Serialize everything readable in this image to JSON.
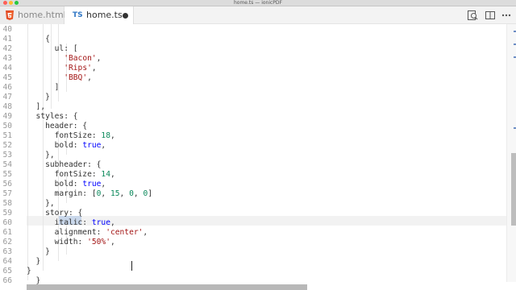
{
  "window": {
    "title": "home.ts — ionicPDF"
  },
  "tabs": [
    {
      "label": "home.html",
      "icon": "html5-icon",
      "active": false
    },
    {
      "label": "home.ts",
      "icon": "typescript-icon",
      "icon_text": "TS",
      "active": true,
      "dirty": true
    }
  ],
  "toolbar": {
    "icons": [
      "open-changes-icon",
      "split-editor-icon",
      "more-actions-icon"
    ]
  },
  "editor": {
    "lines": [
      {
        "num": "40",
        "text": ""
      },
      {
        "num": "41",
        "text": "        {"
      },
      {
        "num": "42",
        "text": "          ul: ["
      },
      {
        "num": "43",
        "text": "            'Bacon',"
      },
      {
        "num": "44",
        "text": "            'Rips',"
      },
      {
        "num": "45",
        "text": "            'BBQ',"
      },
      {
        "num": "46",
        "text": "          ]"
      },
      {
        "num": "47",
        "text": "        }"
      },
      {
        "num": "48",
        "text": "      ],"
      },
      {
        "num": "49",
        "text": "      styles: {"
      },
      {
        "num": "50",
        "text": "        header: {"
      },
      {
        "num": "51",
        "text": "          fontSize: 18,"
      },
      {
        "num": "52",
        "text": "          bold: true,"
      },
      {
        "num": "53",
        "text": "        },"
      },
      {
        "num": "54",
        "text": "        subheader: {"
      },
      {
        "num": "55",
        "text": "          fontSize: 14,"
      },
      {
        "num": "56",
        "text": "          bold: true,"
      },
      {
        "num": "57",
        "text": "          margin: [0, 15, 0, 0]"
      },
      {
        "num": "58",
        "text": "        },"
      },
      {
        "num": "59",
        "text": "        story: {"
      },
      {
        "num": "60",
        "text": "          italic: true,"
      },
      {
        "num": "61",
        "text": "          alignment: 'center',"
      },
      {
        "num": "62",
        "text": "          width: '50%',"
      },
      {
        "num": "63",
        "text": "        }"
      },
      {
        "num": "64",
        "text": "      }"
      },
      {
        "num": "65",
        "text": "    }"
      },
      {
        "num": "66",
        "text": "  }"
      }
    ],
    "current_line": "59",
    "highlighted_word": "story"
  },
  "colors": {
    "string": "#a31515",
    "number": "#09885a",
    "keyword": "#0000ff",
    "line_number": "#999999",
    "word_highlight": "#c9d7ea",
    "html5": "#e44d26",
    "typescript": "#3178c6"
  }
}
